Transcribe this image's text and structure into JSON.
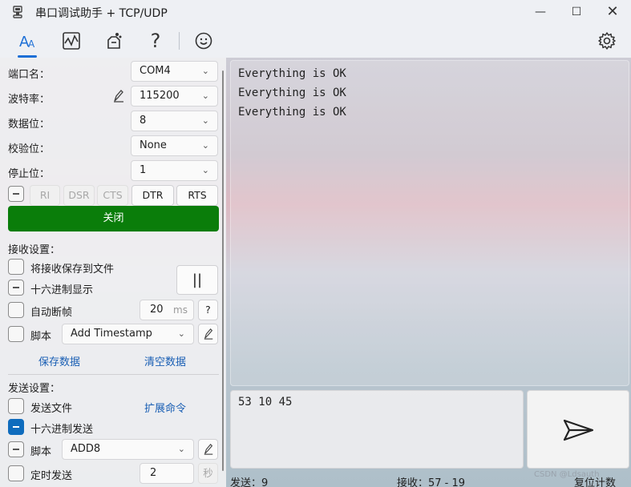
{
  "window": {
    "title": "串口调试助手 + TCP/UDP",
    "controls": [
      "minimize",
      "maximize",
      "close"
    ]
  },
  "toolbar": {
    "icons": [
      "text-mode-icon",
      "chart-icon",
      "plugin-icon",
      "help-icon",
      "smiley-icon",
      "settings-icon"
    ],
    "help_glyph": "?",
    "active": "text-mode-icon",
    "accent": "#1d6fd6"
  },
  "serial": {
    "port_label": "端口名：",
    "port_value": "COM4",
    "baud_label": "波特率：",
    "baud_value": "115200",
    "databits_label": "数据位：",
    "databits_value": "8",
    "parity_label": "校验位：",
    "parity_value": "None",
    "stopbits_label": "停止位：",
    "stopbits_value": "1",
    "signals": [
      "RI",
      "DSR",
      "CTS",
      "DTR",
      "RTS"
    ],
    "open_button": "关闭",
    "open_button_color": "#0a7d0a"
  },
  "receive": {
    "section_label": "接收设置：",
    "save_to_file": "将接收保存到文件",
    "hex_display": "十六进制显示",
    "pause_label": "||",
    "auto_frame": "自动断帧",
    "frame_ms": "20",
    "frame_unit": "ms",
    "frame_help": "?",
    "script_label": "脚本",
    "script_value": "Add Timestamp",
    "save_data": "保存数据",
    "clear_data": "清空数据"
  },
  "send": {
    "section_label": "发送设置：",
    "send_file": "发送文件",
    "ext_commands": "扩展命令",
    "hex_send": "十六进制发送",
    "script_label": "脚本",
    "script_value": "ADD8",
    "timed_send": "定时发送",
    "interval": "2",
    "interval_unit": "秒"
  },
  "rx_lines": [
    "Everything is OK",
    "Everything is OK",
    "Everything is OK"
  ],
  "tx_text": "53 10 45",
  "status": {
    "sent": "发送：9",
    "received": "接收：57 - 19",
    "reset": "复位计数"
  },
  "watermark": "CSDN @Ldsauth"
}
